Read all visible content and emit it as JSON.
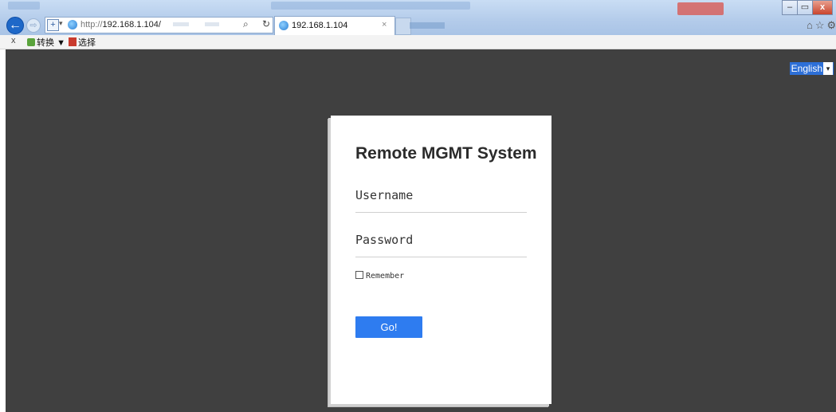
{
  "browser": {
    "address_url": "http://192.168.1.104/",
    "address_proto": "http://",
    "address_host": "192.168.1.104/",
    "tab_title": "192.168.1.104",
    "tab_close": "×",
    "back_glyph": "←",
    "forward_glyph": "⇨",
    "search_glyph": "⌕",
    "refresh_glyph": "↻",
    "window_controls": {
      "minimize": "–",
      "maximize": "▭",
      "close": "x"
    },
    "toolbar_icons": "⌂☆⚙"
  },
  "command_bar": {
    "close": "x",
    "convert_label": "转换",
    "convert_dropdown": "▼",
    "select_label": "选择"
  },
  "page": {
    "background_color": "#404040",
    "language_select": {
      "value": "English",
      "arrow": "▾"
    },
    "login": {
      "title": "Remote MGMT System",
      "username_placeholder": "Username",
      "password_placeholder": "Password",
      "remember_label": "Remember",
      "remember_checked": false,
      "submit_label": "Go!",
      "submit_color": "#2e7cf0"
    }
  }
}
